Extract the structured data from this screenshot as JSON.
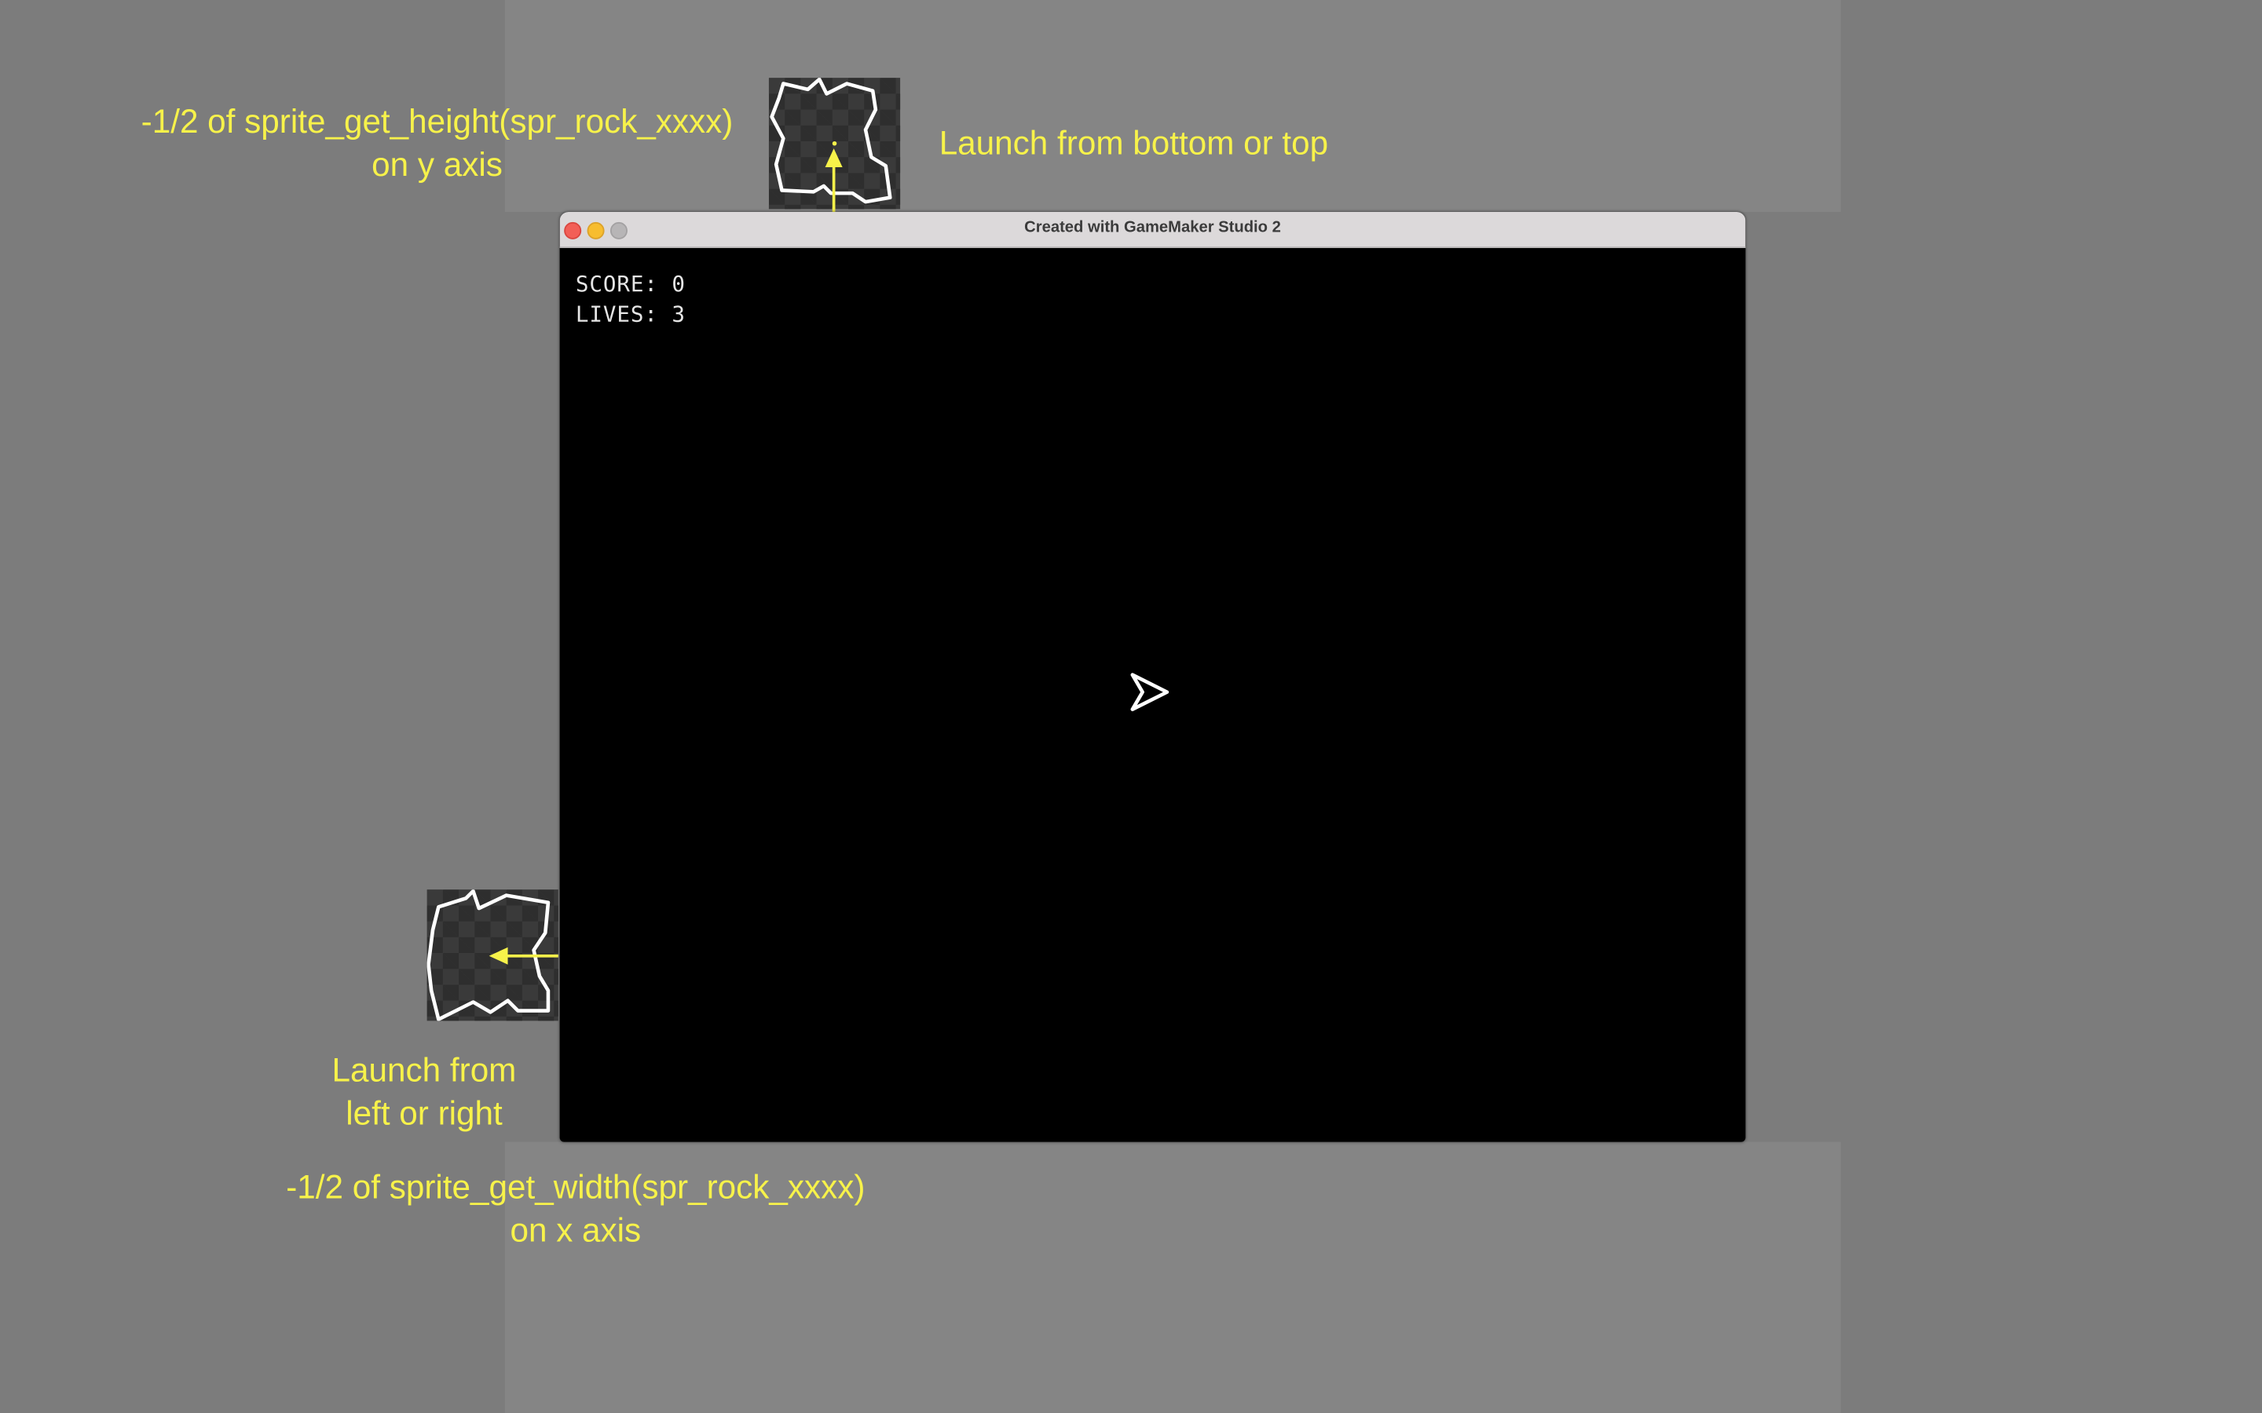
{
  "window": {
    "title": "Created with GameMaker Studio 2",
    "traffic_lights": {
      "close_color": "#f25f57",
      "minimize_color": "#f7bd2f",
      "zoom_color": "#b7b5b6"
    }
  },
  "hud": {
    "score": "SCORE: 0",
    "lives": "LIVES: 3"
  },
  "annotations": {
    "top_offset_line1": "-1/2 of sprite_get_height(spr_rock_xxxx)",
    "top_offset_line2": "on y axis",
    "launch_top": "Launch from bottom or top",
    "launch_side_line1": "Launch from",
    "launch_side_line2": "left or right",
    "side_offset_line1": "-1/2 of sprite_get_width(spr_rock_xxxx)",
    "side_offset_line2": "on x axis"
  },
  "colors": {
    "annotation": "#f7f24a",
    "background": "#7c7c7c",
    "game_bg": "#000000",
    "outline": "#ffffff"
  },
  "icons": {
    "ship": "player-ship-icon",
    "rock": "rock-sprite-icon"
  }
}
